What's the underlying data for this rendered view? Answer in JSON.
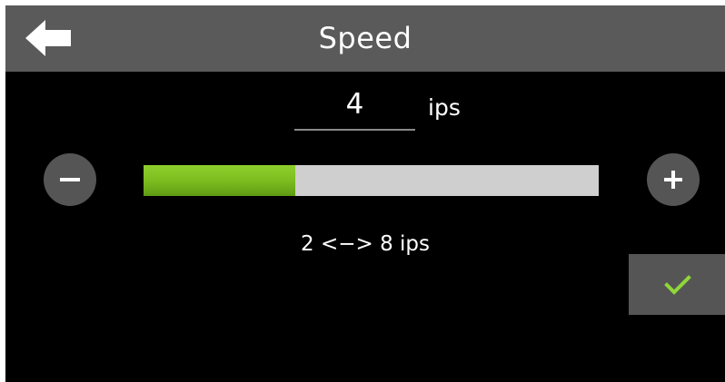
{
  "header": {
    "title": "Speed",
    "back_icon": "back-arrow-icon"
  },
  "speed": {
    "value": "4",
    "unit": "ips",
    "range_text": "2 <−> 8 ips",
    "min": 2,
    "max": 8,
    "level_fraction": 0.333
  },
  "controls": {
    "decrease_icon": "minus-icon",
    "increase_icon": "plus-icon",
    "confirm_icon": "checkmark-icon"
  },
  "colors": {
    "header_bg": "#5a5a5a",
    "screen_bg": "#000000",
    "button_bg": "#555555",
    "slider_fill": "#7dbd1f",
    "slider_track": "#cfcfcf",
    "checkmark": "#8fd63a"
  }
}
